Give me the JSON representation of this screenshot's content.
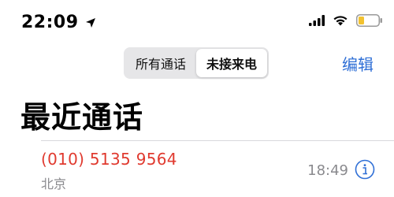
{
  "status_bar": {
    "time": "22:09"
  },
  "segmented_control": {
    "options": [
      {
        "label": "所有通话",
        "selected": false
      },
      {
        "label": "未接来电",
        "selected": true
      }
    ]
  },
  "header": {
    "edit_label": "编辑",
    "title": "最近通话"
  },
  "calls": [
    {
      "number": "(010) 5135 9564",
      "location": "北京",
      "time": "18:49",
      "missed": true
    }
  ],
  "colors": {
    "accent": "#2f6fd6",
    "missed": "#e03a2f",
    "secondary_text": "#8a8a8e",
    "battery_low": "#f2c230"
  },
  "icons": {
    "location": "location-arrow-icon",
    "signal": "cellular-signal-icon",
    "wifi": "wifi-icon",
    "battery": "battery-icon",
    "info": "info-icon"
  }
}
